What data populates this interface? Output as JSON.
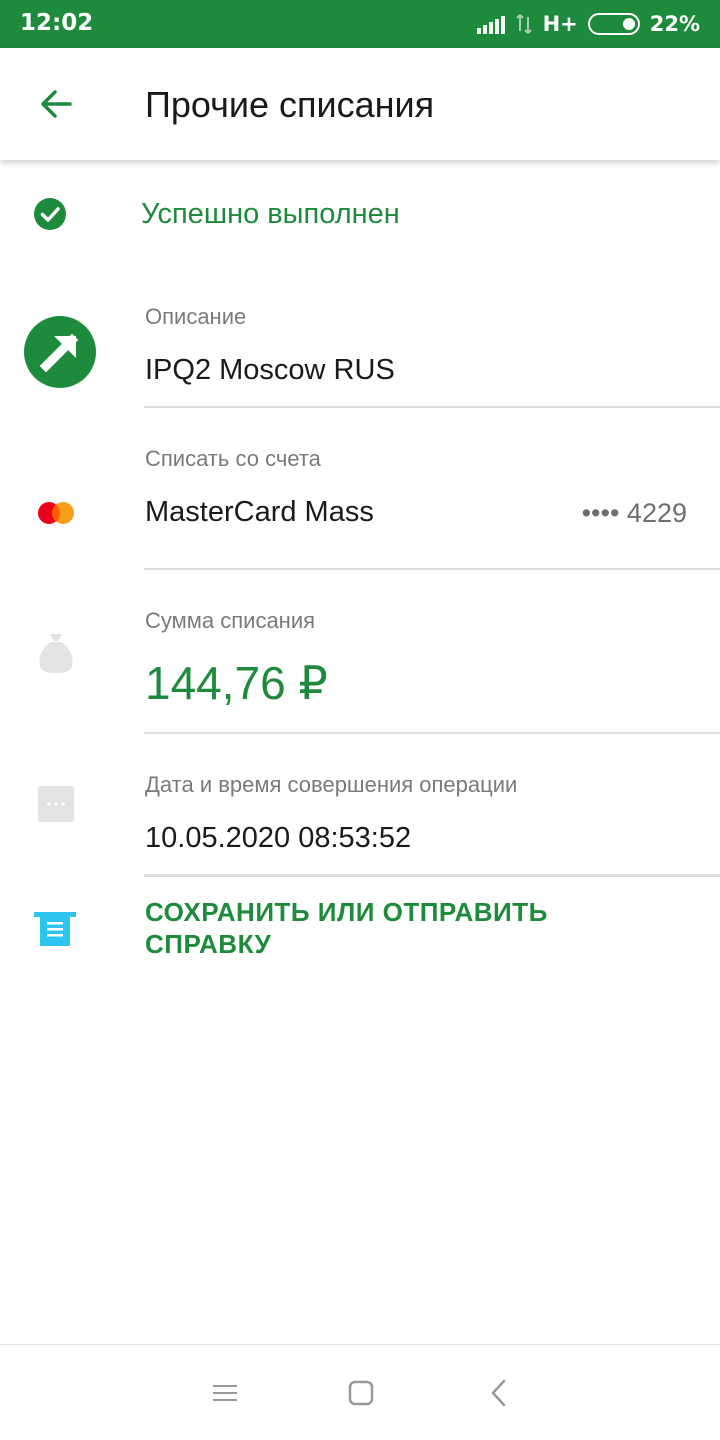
{
  "status_bar": {
    "time": "12:02",
    "network": "H+",
    "battery": "22%",
    "battery_level": 0.22
  },
  "app_bar": {
    "back_icon": "arrow-left-icon",
    "title": "Прочие списания"
  },
  "transaction": {
    "status_icon": "check-circle-icon",
    "status_text": "Успешно выполнен",
    "description": {
      "icon": "arrow-up-right-icon",
      "label": "Описание",
      "value": "IPQ2 Moscow RUS"
    },
    "account": {
      "icon": "mastercard-icon",
      "label": "Списать со счета",
      "value": "MasterCard Mass",
      "mask": "•••• 4229"
    },
    "amount": {
      "icon": "money-bag-icon",
      "label": "Сумма списания",
      "value": "144,76 ₽"
    },
    "datetime": {
      "icon": "more-dots-icon",
      "label": "Дата и время совершения операции",
      "value": "10.05.2020 08:53:52"
    },
    "action": {
      "icon": "receipt-icon",
      "label": "СОХРАНИТЬ ИЛИ ОТПРАВИТЬ СПРАВКУ"
    }
  },
  "nav_bar": {
    "menu_icon": "menu-icon",
    "home_icon": "home-square-icon",
    "back_icon": "back-chevron-icon"
  },
  "colors": {
    "brand_green": "#1e8a3c",
    "mastercard_red": "#eb001b",
    "mastercard_orange": "#f79e1b",
    "receipt_blue": "#2ec4f0"
  }
}
